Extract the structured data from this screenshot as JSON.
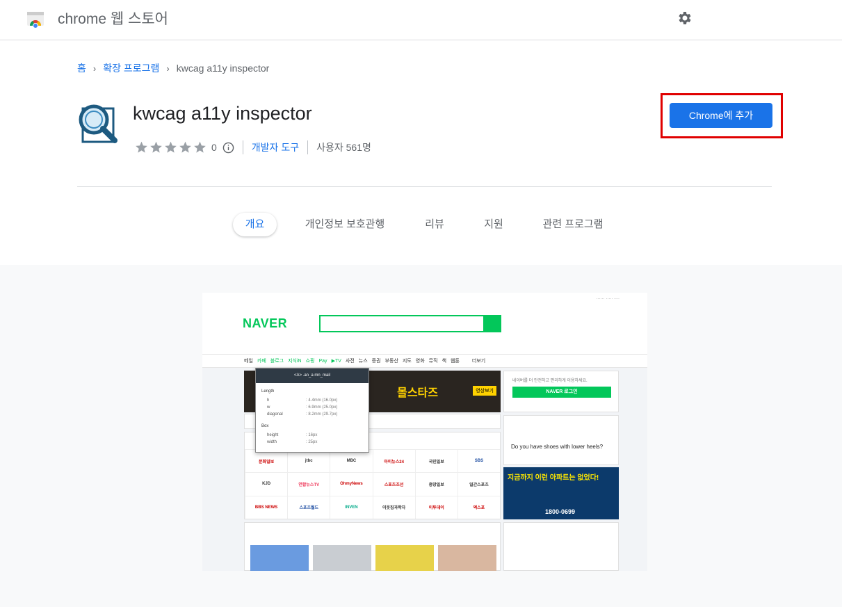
{
  "header": {
    "store_title": "chrome 웹 스토어",
    "settings_icon": "gear-icon"
  },
  "breadcrumb": {
    "home": "홈",
    "category": "확장 프로그램",
    "current": "kwcag a11y inspector"
  },
  "extension": {
    "name": "kwcag a11y inspector",
    "rating": 0,
    "rating_count": "0",
    "category": "개발자 도구",
    "users": "사용자 561명",
    "add_button": "Chrome에 추가"
  },
  "tabs": [
    {
      "label": "개요",
      "active": true
    },
    {
      "label": "개인정보 보호관행",
      "active": false
    },
    {
      "label": "리뷰",
      "active": false
    },
    {
      "label": "지원",
      "active": false
    },
    {
      "label": "관련 프로그램",
      "active": false
    }
  ],
  "screenshot": {
    "logo": "NAVER",
    "menu": [
      "메일",
      "카페",
      "블로그",
      "지식iN",
      "쇼핑",
      "Pay",
      "▶TV",
      "사전",
      "뉴스",
      "증권",
      "부동산",
      "지도",
      "영화",
      "뮤직",
      "책",
      "웹툰",
      "더보기"
    ],
    "banner_text": "몰스타즈",
    "banner_button": "영상보기",
    "login_text": "네이버를 더 안전하고 편리하게 이용하세요.",
    "login_button": "NAVER 로그인",
    "weather_question": "Do you have shoes with lower heels?",
    "ad_headline": "지금까지 이런 아파트는 없었다!",
    "ad_phone": "1800-0699",
    "press": [
      "문화일보",
      "jtbc",
      "MBC",
      "아이뉴스24",
      "국민일보",
      "SBS",
      "KJD",
      "연합뉴스TV",
      "OhmyNews",
      "스포츠조선",
      "중앙일보",
      "일간스포츠",
      "BBS NEWS",
      "스포츠월드",
      "INVEN",
      "이웃집과학자",
      "이투데이",
      "엑스포"
    ],
    "popup": {
      "title": "<A> .an_a mn_mail",
      "length_label": "Length",
      "box_label": "Box",
      "rows": [
        {
          "k": "h",
          "v": ": 4.4mm (16.0px)"
        },
        {
          "k": "w",
          "v": ": 6.9mm (25.0px)"
        },
        {
          "k": "diagonal",
          "v": ": 8.2mm (29.7px)"
        },
        {
          "k": "height",
          "v": ": 16px"
        },
        {
          "k": "width",
          "v": ": 25px"
        }
      ]
    }
  }
}
